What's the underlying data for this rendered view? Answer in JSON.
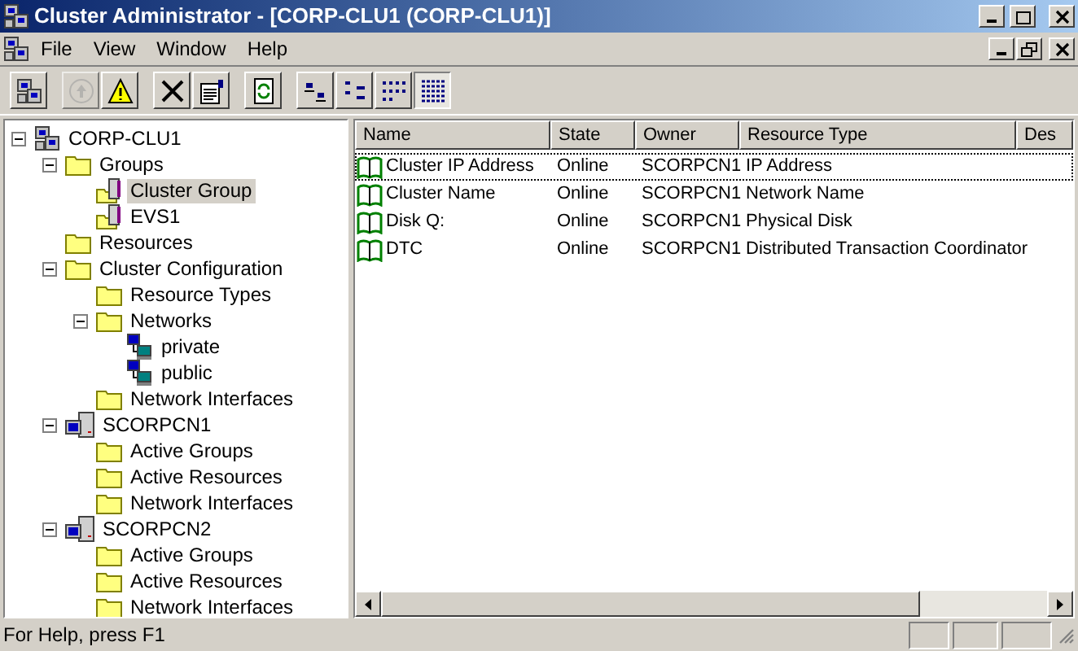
{
  "window": {
    "title": "Cluster Administrator - [CORP-CLU1 (CORP-CLU1)]"
  },
  "menu": [
    "File",
    "View",
    "Window",
    "Help"
  ],
  "toolbar": [
    {
      "kind": "cluster",
      "disabled": false,
      "pressed": false
    },
    {
      "kind": "bring-online",
      "disabled": true,
      "pressed": false
    },
    {
      "kind": "warning",
      "disabled": false,
      "pressed": false
    },
    {
      "kind": "delete",
      "disabled": false,
      "pressed": false
    },
    {
      "kind": "properties",
      "disabled": false,
      "pressed": false
    },
    {
      "kind": "refresh",
      "disabled": false,
      "pressed": false
    },
    {
      "kind": "large-icons",
      "disabled": false,
      "pressed": false
    },
    {
      "kind": "small-icons",
      "disabled": false,
      "pressed": false
    },
    {
      "kind": "list",
      "disabled": false,
      "pressed": false
    },
    {
      "kind": "details",
      "disabled": false,
      "pressed": true
    }
  ],
  "tree": [
    {
      "label": "CORP-CLU1",
      "kind": "cluster",
      "selected": false,
      "expanded": true,
      "children": [
        {
          "label": "Groups",
          "kind": "folder",
          "selected": false,
          "expanded": true,
          "children": [
            {
              "label": "Cluster Group",
              "kind": "group",
              "selected": true
            },
            {
              "label": "EVS1",
              "kind": "group",
              "selected": false
            }
          ]
        },
        {
          "label": "Resources",
          "kind": "folder",
          "selected": false
        },
        {
          "label": "Cluster Configuration",
          "kind": "folder",
          "selected": false,
          "expanded": true,
          "children": [
            {
              "label": "Resource Types",
              "kind": "folder",
              "selected": false
            },
            {
              "label": "Networks",
              "kind": "folder",
              "selected": false,
              "expanded": true,
              "children": [
                {
                  "label": "private",
                  "kind": "network",
                  "selected": false
                },
                {
                  "label": "public",
                  "kind": "network",
                  "selected": false
                }
              ]
            },
            {
              "label": "Network Interfaces",
              "kind": "folder",
              "selected": false
            }
          ]
        },
        {
          "label": "SCORPCN1",
          "kind": "node",
          "selected": false,
          "expanded": true,
          "children": [
            {
              "label": "Active Groups",
              "kind": "folder",
              "selected": false
            },
            {
              "label": "Active Resources",
              "kind": "folder",
              "selected": false
            },
            {
              "label": "Network Interfaces",
              "kind": "folder",
              "selected": false
            }
          ]
        },
        {
          "label": "SCORPCN2",
          "kind": "node",
          "selected": false,
          "expanded": true,
          "children": [
            {
              "label": "Active Groups",
              "kind": "folder",
              "selected": false
            },
            {
              "label": "Active Resources",
              "kind": "folder",
              "selected": false
            },
            {
              "label": "Network Interfaces",
              "kind": "folder",
              "selected": false
            }
          ]
        }
      ]
    }
  ],
  "table": {
    "columns": [
      "Name",
      "State",
      "Owner",
      "Resource Type",
      "Des"
    ],
    "rows": [
      {
        "cells": [
          "Cluster IP Address",
          "Online",
          "SCORPCN1",
          "IP Address"
        ],
        "focused": true
      },
      {
        "cells": [
          "Cluster Name",
          "Online",
          "SCORPCN1",
          "Network Name"
        ],
        "focused": false
      },
      {
        "cells": [
          "Disk Q:",
          "Online",
          "SCORPCN1",
          "Physical Disk"
        ],
        "focused": false
      },
      {
        "cells": [
          "DTC",
          "Online",
          "SCORPCN1",
          "Distributed Transaction Coordinator"
        ],
        "focused": false
      }
    ]
  },
  "status_bar": {
    "text": "For Help, press F1"
  }
}
